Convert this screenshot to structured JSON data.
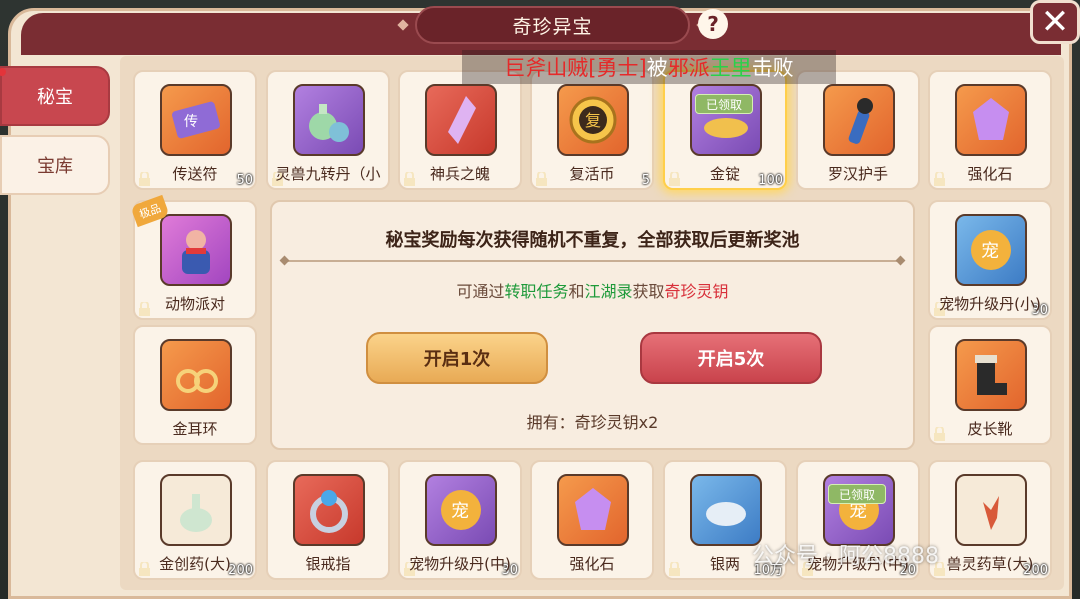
{
  "header": {
    "title": "奇珍异宝",
    "help": "?",
    "close": "✕"
  },
  "tabs": [
    {
      "label": "秘宝"
    },
    {
      "label": "宝库"
    }
  ],
  "banner": {
    "part1": "巨斧山贼[勇士]",
    "part2": "被",
    "part3": "邪派",
    "part4": "王里",
    "part5": "击败"
  },
  "items": [
    {
      "name": "传送符",
      "qty": "50",
      "bg": "orange"
    },
    {
      "name": "灵兽九转丹（小",
      "qty": "",
      "bg": "purple"
    },
    {
      "name": "神兵之魄",
      "qty": "",
      "bg": "red"
    },
    {
      "name": "复活币",
      "qty": "5",
      "bg": "orange"
    },
    {
      "name": "金锭",
      "qty": "100",
      "bg": "purple",
      "status": "已领取"
    },
    {
      "name": "罗汉护手",
      "qty": "",
      "bg": "orange"
    },
    {
      "name": "强化石",
      "qty": "",
      "bg": "orange"
    },
    {
      "name": "动物派对",
      "qty": "",
      "bg": "pink",
      "badge": "极品"
    },
    {
      "name": "宠物升级丹(小)",
      "qty": "30",
      "bg": "blue"
    },
    {
      "name": "金耳环",
      "qty": "",
      "bg": "orange"
    },
    {
      "name": "皮长靴",
      "qty": "",
      "bg": "orange"
    },
    {
      "name": "金创药(大)",
      "qty": "200",
      "bg": "orange"
    },
    {
      "name": "银戒指",
      "qty": "",
      "bg": "red"
    },
    {
      "name": "宠物升级丹(中)",
      "qty": "30",
      "bg": "purple"
    },
    {
      "name": "强化石",
      "qty": "",
      "bg": "orange"
    },
    {
      "name": "银两",
      "qty": "10万",
      "bg": "blue"
    },
    {
      "name": "宠物升级丹(中)",
      "qty": "20",
      "bg": "purple",
      "status": "已领取"
    },
    {
      "name": "兽灵药草(大)",
      "qty": "200",
      "bg": "orange"
    }
  ],
  "panel": {
    "title": "秘宝奖励每次获得随机不重复，全部获取后更新奖池",
    "desc_prefix": "可通过",
    "desc_task": "转职任务",
    "desc_and": "和",
    "desc_book": "江湖录",
    "desc_get": "获取",
    "desc_key": "奇珍灵钥",
    "btn_one": "开启1次",
    "btn_five": "开启5次",
    "own": "拥有：奇珍灵钥x2"
  },
  "watermark": "公众号 · 阿公8888"
}
